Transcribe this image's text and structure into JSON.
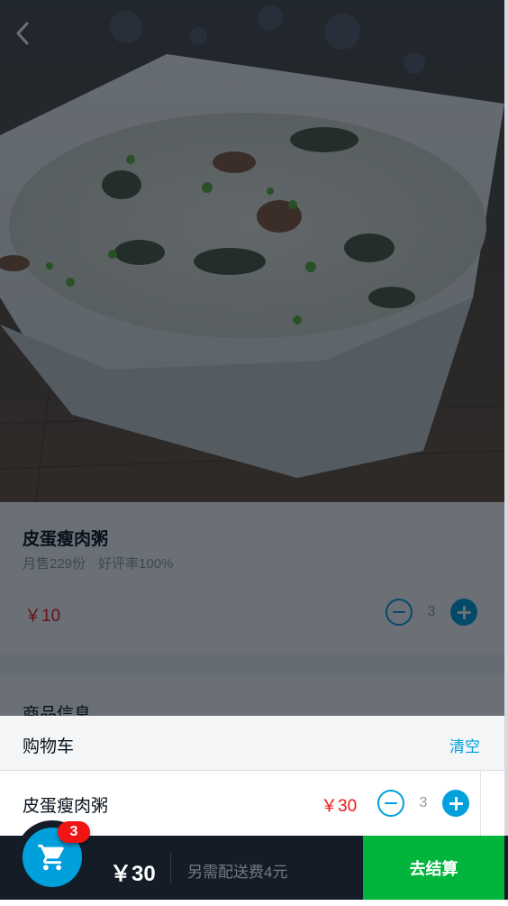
{
  "food": {
    "name": "皮蛋瘦肉粥",
    "sell_count": "月售229份",
    "rating": "好评率100%",
    "price": "￥10",
    "count": "3"
  },
  "detail": {
    "title": "商品信息"
  },
  "cart": {
    "title": "购物车",
    "clear_label": "清空",
    "items": [
      {
        "name": "皮蛋瘦肉粥",
        "price": "￥30",
        "count": "3"
      }
    ]
  },
  "shopcart": {
    "badge": "3",
    "total": "￥30",
    "delivery_desc": "另需配送费4元",
    "pay_label": "去结算"
  },
  "icons": {
    "back": "chevron-left-icon",
    "cart": "shopping-cart-icon",
    "minus": "minus-circle-icon",
    "plus": "plus-circle-icon"
  },
  "colors": {
    "accent": "#00a0dc",
    "price": "#f01414",
    "pay": "#00b43c",
    "bar": "#141d27"
  }
}
